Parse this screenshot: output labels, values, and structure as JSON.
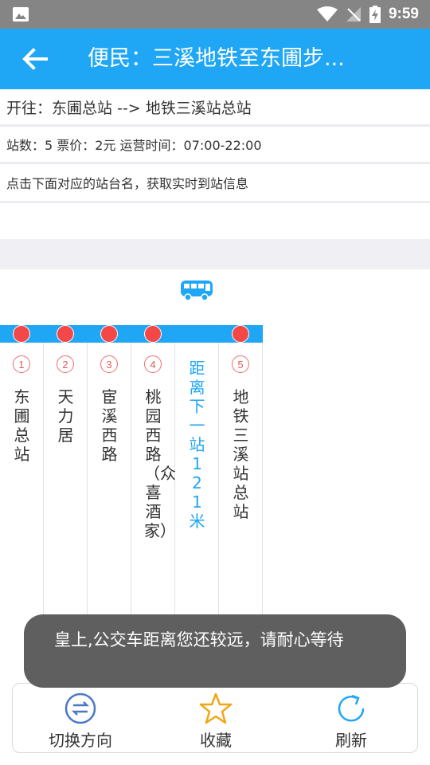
{
  "status_bar": {
    "time": "9:59"
  },
  "app_bar": {
    "title": "便民：三溪地铁至东圃步..."
  },
  "route": {
    "direction": "开往：东圃总站 --> 地铁三溪站总站",
    "details": "站数：5  票价：2元  运营时间：07:00-22:00",
    "hint": "点击下面对应的站台名，获取实时到站信息"
  },
  "stations": [
    {
      "num": "1",
      "name": "东圃总站"
    },
    {
      "num": "2",
      "name": "天力居"
    },
    {
      "num": "3",
      "name": "宦溪西路"
    },
    {
      "num": "4",
      "name": "桃园西路（众喜酒家）"
    },
    {
      "num": "",
      "name": "距离下一站121米"
    },
    {
      "num": "5",
      "name": "地铁三溪站总站"
    }
  ],
  "bottom_bar": {
    "switch_label": "切换方向",
    "favorite_label": "收藏",
    "refresh_label": "刷新"
  },
  "toast": {
    "message": "皇上,公交车距离您还较远，请耐心等待"
  },
  "colors": {
    "primary": "#1fa6f5",
    "dot": "#f44848"
  }
}
